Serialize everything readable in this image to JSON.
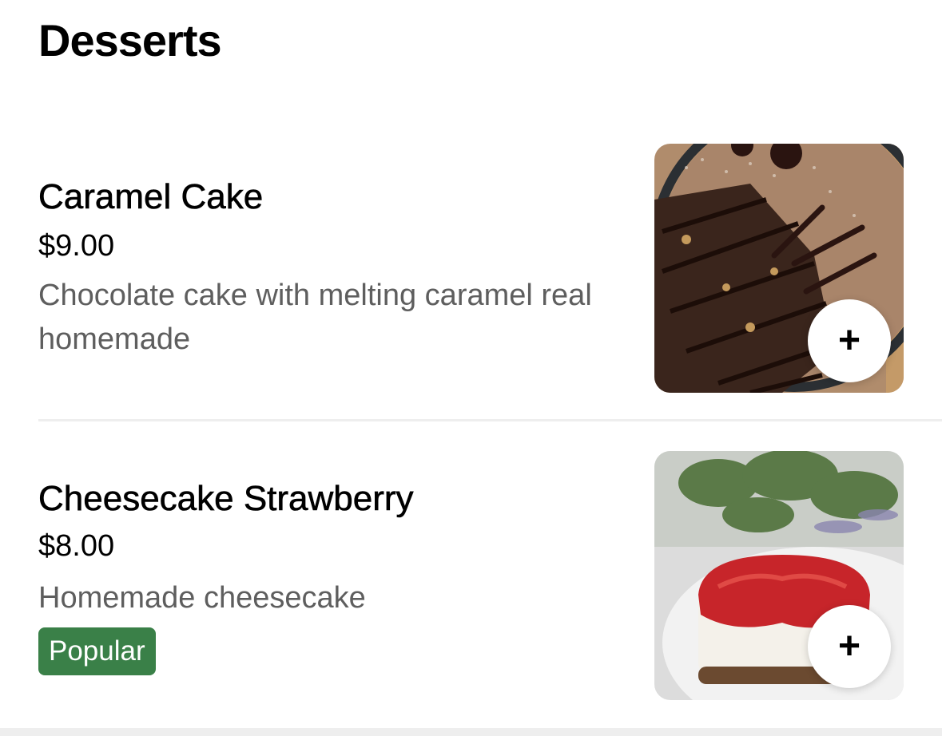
{
  "section": {
    "title": "Desserts"
  },
  "items": [
    {
      "name": "Caramel Cake",
      "price": "$9.00",
      "description": "Chocolate cake with melting caramel real homemade",
      "image_icon": "caramel-cake-photo",
      "add_icon": "plus-icon",
      "add_glyph": "+"
    },
    {
      "name": "Cheesecake Strawberry",
      "price": "$8.00",
      "description": "Homemade cheesecake",
      "badge": "Popular",
      "image_icon": "cheesecake-photo",
      "add_icon": "plus-icon",
      "add_glyph": "+"
    }
  ],
  "colors": {
    "badge_bg": "#3a8048",
    "secondary_text": "#5e5e5e",
    "divider": "#eeeeee"
  }
}
